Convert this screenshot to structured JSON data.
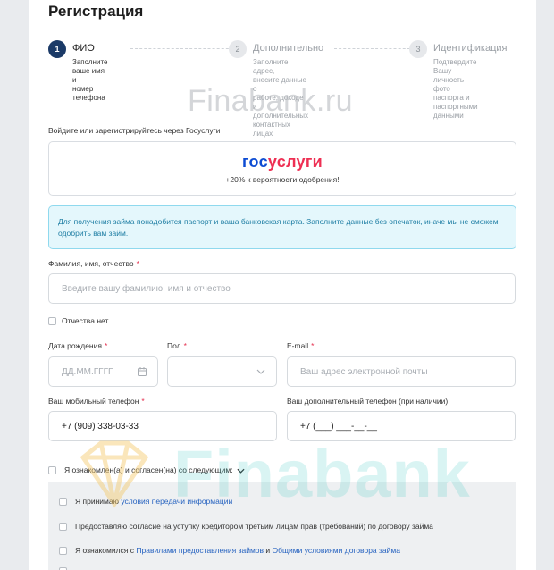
{
  "page": {
    "title": "Регистрация"
  },
  "steps": [
    {
      "num": "1",
      "label": "ФИО",
      "desc": [
        "Заполните ваше имя и",
        "номер телефона"
      ]
    },
    {
      "num": "2",
      "label": "Дополнительно",
      "desc": [
        "Заполните адрес,",
        "внесите данные о",
        "работе, доходе и",
        "дополнительных",
        "контактных лицах"
      ]
    },
    {
      "num": "3",
      "label": "Идентификация",
      "desc": [
        "Подтвердите Вашу",
        "личность фото",
        "паспорта и",
        "паспортными",
        "данными"
      ]
    }
  ],
  "watermark": {
    "top": "Finabank.ru",
    "bottom": "Finabank"
  },
  "gosuslugi": {
    "caption": "Войдите или зарегистрируйтесь через Госуслуги",
    "logo_part1": "гос",
    "logo_part2": "услуги",
    "subtitle": "+20% к вероятности одобрения!"
  },
  "info": {
    "text": "Для получения займа понадобится паспорт и ваша банковская карта. Заполните данные без опечаток, иначе мы не сможем одобрить вам займ."
  },
  "form": {
    "fio": {
      "label": "Фамилия, имя, отчество",
      "placeholder": "Введите вашу фамилию, имя и отчество"
    },
    "no_patronymic": "Отчества нет",
    "birthdate": {
      "label": "Дата рождения",
      "placeholder": "ДД.ММ.ГГГГ"
    },
    "gender": {
      "label": "Пол",
      "value": ""
    },
    "email": {
      "label": "E-mail",
      "placeholder": "Ваш адрес электронной почты"
    },
    "phone": {
      "label": "Ваш мобильный телефон",
      "value": "+7 (909) 338-03-33"
    },
    "phone2": {
      "label": "Ваш дополнительный телефон (при наличии)",
      "value": "+7 (___) ___-__-__"
    },
    "required_mark": "*"
  },
  "agreements": {
    "master": "Я ознакомлен(а) и согласен(на) со следующим:",
    "items": [
      {
        "prefix": "Я принимаю ",
        "link1": "условия передачи информации",
        "mid": "",
        "link2": ""
      },
      {
        "prefix": "Предоставляю согласие на уступку кредитором третьим лицам прав (требований) по договору займа",
        "link1": "",
        "mid": "",
        "link2": ""
      },
      {
        "prefix": "Я ознакомился с ",
        "link1": "Правилами предоставления займов",
        "mid": " и ",
        "link2": "Общими условиями договора займа"
      }
    ]
  },
  "colors": {
    "primary": "#1b3a67",
    "accent": "#ee2f53",
    "gos_blue": "#0d4cd3",
    "info_text": "#1d7da3",
    "link": "#2763c0"
  }
}
